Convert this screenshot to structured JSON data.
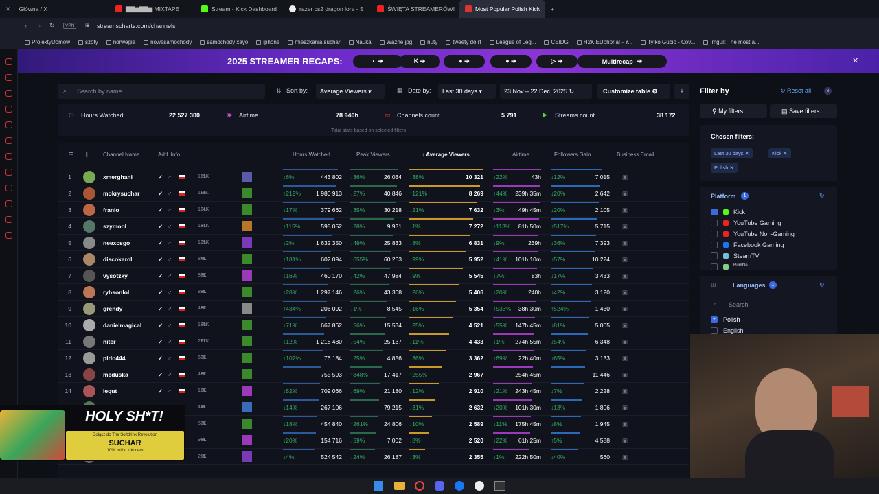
{
  "browser": {
    "tabs": [
      "Główna / X",
      "▇▇▆▇▇▆ MIXTAPE",
      "Stream - Kick Dashboard",
      "razer cs2 dragon lore - S",
      "ŚWIĘTA STREAMERÓW!",
      "Most Popular Polish Kick"
    ],
    "url": "streamscharts.com/channels",
    "vpn": "VPN"
  },
  "bookmarks": [
    "ProjektyDomow",
    "szoty",
    "norwegia",
    "nowesamochody",
    "samochody xayo",
    "iphone",
    "mieszkania suchar",
    "Nauka",
    "Ważne jpg",
    "nuty",
    "tweety do rt",
    "League of Leg...",
    "CEIDG",
    "H2K EUphoria! - Y...",
    "Tylko Gucio - Cov...",
    "Imgur: The most a..."
  ],
  "banner": {
    "title": "2025 STREAMER RECAPS:",
    "multi": "Multirecap"
  },
  "toolbar": {
    "search_placeholder": "Search by name",
    "sort_label": "Sort by:",
    "sort_value": "Average Viewers",
    "date_label": "Date by:",
    "date_value": "Last 30 days",
    "date_range": "23 Nov – 22 Dec, 2025",
    "customize": "Customize table"
  },
  "stats": {
    "hours_label": "Hours Watched",
    "hours": "22 527 300",
    "airtime_label": "Airtime",
    "airtime": "78 940h",
    "channels_label": "Channels count",
    "channels": "5 791",
    "streams_label": "Streams count",
    "streams": "38 172",
    "note": "Total stats based on selected filters"
  },
  "headers": {
    "channel": "Channel Name",
    "info": "Add. Info",
    "hours": "Hours Watched",
    "peak": "Peak Viewers",
    "avg": "Average Viewers",
    "airtime": "Airtime",
    "followers": "Followers Gain",
    "email": "Business Email"
  },
  "rows": [
    {
      "r": "1",
      "n": "xmerghani",
      "f": "169K",
      "hp": "↓6%",
      "h": "443 802",
      "pp": "↓36%",
      "p": "26 034",
      "ap": "↓38%",
      "a": "10 321",
      "tp": "↓22%",
      "t": "43h",
      "fp": "↓12%",
      "fg": "7 015"
    },
    {
      "r": "2",
      "n": "mokrysuchar",
      "f": "118K",
      "hp": "↑219%",
      "h": "1 980 913",
      "pp": "↓27%",
      "p": "40 846",
      "ap": "↑121%",
      "a": "8 269",
      "tp": "↑44%",
      "t": "239h 35m",
      "fp": "↓20%",
      "fg": "2 642"
    },
    {
      "r": "3",
      "n": "franio",
      "f": "104K",
      "hp": "↓17%",
      "h": "379 662",
      "pp": "↓35%",
      "p": "30 218",
      "ap": "↓21%",
      "a": "7 632",
      "tp": "↓3%",
      "t": "49h 45m",
      "fp": "↓20%",
      "fg": "2 105"
    },
    {
      "r": "4",
      "n": "szymool",
      "f": "181K",
      "hp": "↑115%",
      "h": "595 052",
      "pp": "↓28%",
      "p": "9 931",
      "ap": "↓1%",
      "a": "7 272",
      "tp": "↑113%",
      "t": "81h 50m",
      "fp": "↑517%",
      "fg": "5 715"
    },
    {
      "r": "5",
      "n": "neexcsgo",
      "f": "109K",
      "hp": "↓2%",
      "h": "1 632 350",
      "pp": "↓49%",
      "p": "25 833",
      "ap": "↓8%",
      "a": "6 831",
      "tp": "↓9%",
      "t": "239h",
      "fp": "↓36%",
      "fg": "7 393"
    },
    {
      "r": "6",
      "n": "discokarol",
      "f": "84K",
      "hp": "↑181%",
      "h": "602 094",
      "pp": "↑655%",
      "p": "60 263",
      "ap": "↓99%",
      "a": "5 952",
      "tp": "↑41%",
      "t": "101h 10m",
      "fp": "↓57%",
      "fg": "10 224"
    },
    {
      "r": "7",
      "n": "vysotzky",
      "f": "86K",
      "hp": "↓16%",
      "h": "460 170",
      "pp": "↓42%",
      "p": "47 984",
      "ap": "↓9%",
      "a": "5 545",
      "tp": "↓7%",
      "t": "83h",
      "fp": "↓17%",
      "fg": "3 433"
    },
    {
      "r": "8",
      "n": "rybsonlol",
      "f": "83K",
      "hp": "↓28%",
      "h": "1 297 146",
      "pp": "↓26%",
      "p": "43 368",
      "ap": "↓26%",
      "a": "5 406",
      "tp": "↓20%",
      "t": "240h",
      "fp": "↓42%",
      "fg": "3 120"
    },
    {
      "r": "9",
      "n": "grendy",
      "f": "48K",
      "hp": "↑434%",
      "h": "206 092",
      "pp": "↓1%",
      "p": "8 545",
      "ap": "↓16%",
      "a": "5 354",
      "tp": "↑533%",
      "t": "38h 30m",
      "fp": "↑524%",
      "fg": "1 430"
    },
    {
      "r": "10",
      "n": "danielmagical",
      "f": "120K",
      "hp": "↓71%",
      "h": "667 862",
      "pp": "↓56%",
      "p": "15 534",
      "ap": "↓25%",
      "a": "4 521",
      "tp": "↓55%",
      "t": "147h 45m",
      "fp": "↓81%",
      "fg": "5 005"
    },
    {
      "r": "11",
      "n": "niter",
      "f": "217K",
      "hp": "↓12%",
      "h": "1 218 480",
      "pp": "↓54%",
      "p": "25 137",
      "ap": "↓11%",
      "a": "4 433",
      "tp": "↓1%",
      "t": "274h 55m",
      "fp": "↓54%",
      "fg": "6 348"
    },
    {
      "r": "12",
      "n": "pirlo444",
      "f": "60K",
      "hp": "↑102%",
      "h": "76 184",
      "pp": "↓25%",
      "p": "4 856",
      "ap": "↓36%",
      "a": "3 362",
      "tp": "↑69%",
      "t": "22h 40m",
      "fp": "↓65%",
      "fg": "3 133"
    },
    {
      "r": "13",
      "n": "meduska",
      "f": "48K",
      "hp": "",
      "h": "755 593",
      "pp": "↑848%",
      "p": "17 417",
      "ap": "↑255%",
      "a": "2 967",
      "tp": "",
      "t": "254h 45m",
      "fp": "",
      "fg": "11 446"
    },
    {
      "r": "14",
      "n": "lequt",
      "f": "16K",
      "hp": "↓52%",
      "h": "709 066",
      "pp": "↓69%",
      "p": "21 180",
      "ap": "↓12%",
      "a": "2 910",
      "tp": "↓21%",
      "t": "243h 45m",
      "fp": "↓7%",
      "fg": "2 228"
    },
    {
      "r": "15",
      "n": "xntentacion",
      "f": "44K",
      "hp": "↓14%",
      "h": "267 106",
      "pp": "",
      "p": "79 215",
      "ap": "↓31%",
      "a": "2 632",
      "tp": "↓20%",
      "t": "101h 30m",
      "fp": "↓13%",
      "fg": "1 806"
    },
    {
      "r": "16",
      "n": "",
      "f": "53K",
      "hp": "↓18%",
      "h": "454 840",
      "pp": "↑261%",
      "p": "24 806",
      "ap": "↓10%",
      "a": "2 589",
      "tp": "↓11%",
      "t": "175h 45m",
      "fp": "↓8%",
      "fg": "1 945"
    },
    {
      "r": "17",
      "n": "",
      "f": "95K",
      "hp": "↓20%",
      "h": "154 716",
      "pp": "↓59%",
      "p": "7 002",
      "ap": "↓8%",
      "a": "2 520",
      "tp": "↓22%",
      "t": "61h 25m",
      "fp": "↑5%",
      "fg": "4 588"
    },
    {
      "r": "18",
      "n": "",
      "f": "25K",
      "hp": "↓4%",
      "h": "524 542",
      "pp": "↓24%",
      "p": "26 187",
      "ap": "↓3%",
      "a": "2 355",
      "tp": "↓1%",
      "t": "222h 50m",
      "fp": "↓40%",
      "fg": "560"
    }
  ],
  "side": {
    "filter_by": "Filter by",
    "reset": "Reset all",
    "reset_count": "3",
    "my_filters": "My filters",
    "save_filters": "Save filters",
    "chosen": "Chosen filters:",
    "chips": [
      "Last 30 days",
      "Kick",
      "Polish"
    ],
    "platform": "Platform",
    "platform_count": "1",
    "platforms": [
      "Kick",
      "YouTube Gaming",
      "YouTube Non-Gaming",
      "Facebook Gaming",
      "SteamTV",
      "Rumble"
    ],
    "languages": "Languages",
    "languages_count": "1",
    "lang_search": "Search",
    "langs": [
      "Polish",
      "English"
    ]
  },
  "ad": {
    "title": "HOLY SH*T!",
    "line1": "Dołącz do The Softdrink Revolution",
    "brand": "SUCHAR",
    "line2": "10% zniżki z kodem"
  }
}
